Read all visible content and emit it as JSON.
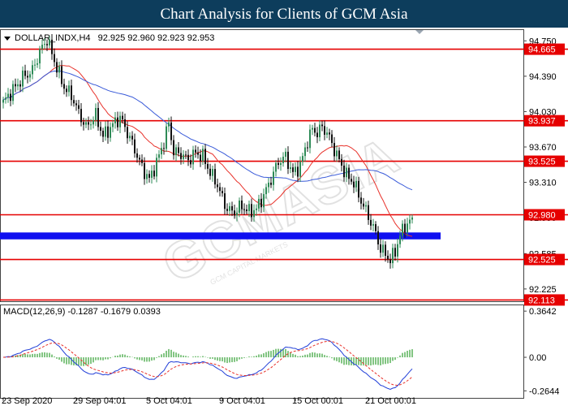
{
  "page": {
    "title": "Chart Analysis for Clients of GCM Asia"
  },
  "colors": {
    "banner": "#0d3d5c",
    "bull_candle": "#2e8b57",
    "bear_candle": "#111111",
    "level_line": "#e60000",
    "ma_fast": "#e8312a",
    "ma_slow": "#3a5bd9",
    "support_zone": "#1010f0",
    "macd_line": "#2340d8",
    "signal_line": "#e8312a",
    "histogram": "#2e9e2e"
  },
  "watermark": {
    "text": "GCMASIA",
    "subtext": "GCM CAPITAL MARKETS"
  },
  "chart_data": {
    "type": "candlestick",
    "symbol": "DOLLAR_INDX,H4",
    "ohlc_header": "92.925 92.960 92.923 92.953",
    "ylim": [
      92.1,
      94.86
    ],
    "price_ticks": [
      "94.750",
      "94.390",
      "94.030",
      "93.670",
      "93.310",
      "92.950",
      "92.585",
      "92.225"
    ],
    "price_tick_values": [
      94.75,
      94.39,
      94.03,
      93.67,
      93.31,
      92.95,
      92.585,
      92.225
    ],
    "time_labels": [
      "23 Sep 2020",
      "29 Sep 04:01",
      "5 Oct 04:01",
      "9 Oct 04:01",
      "15 Oct 00:01",
      "21 Oct 00:01"
    ],
    "time_label_bars": [
      0,
      30,
      60,
      90,
      120,
      150
    ],
    "levels": [
      {
        "label": "94.665",
        "value": 94.665
      },
      {
        "label": "93.937",
        "value": 93.937
      },
      {
        "label": "93.525",
        "value": 93.525
      },
      {
        "label": "92.980",
        "value": 92.98
      },
      {
        "label": "92.525",
        "value": 92.525
      },
      {
        "label": "92.113",
        "value": 92.113
      }
    ],
    "support_zone": {
      "from": 92.73,
      "to": 92.8,
      "start_bar": 0,
      "end_bar": 179
    },
    "close_anchors": [
      [
        0,
        94.1
      ],
      [
        4,
        94.25
      ],
      [
        8,
        94.4
      ],
      [
        12,
        94.45
      ],
      [
        15,
        94.62
      ],
      [
        18,
        94.75
      ],
      [
        21,
        94.55
      ],
      [
        25,
        94.3
      ],
      [
        28,
        94.2
      ],
      [
        31,
        94.0
      ],
      [
        34,
        93.85
      ],
      [
        38,
        94.0
      ],
      [
        41,
        93.8
      ],
      [
        45,
        93.9
      ],
      [
        48,
        93.95
      ],
      [
        51,
        93.8
      ],
      [
        54,
        93.65
      ],
      [
        57,
        93.48
      ],
      [
        60,
        93.35
      ],
      [
        63,
        93.5
      ],
      [
        66,
        93.7
      ],
      [
        68,
        93.9
      ],
      [
        70,
        93.62
      ],
      [
        73,
        93.62
      ],
      [
        76,
        93.55
      ],
      [
        79,
        93.6
      ],
      [
        82,
        93.55
      ],
      [
        85,
        93.4
      ],
      [
        88,
        93.3
      ],
      [
        91,
        93.1
      ],
      [
        93,
        93.03
      ],
      [
        95,
        93.0
      ],
      [
        98,
        93.05
      ],
      [
        101,
        93.0
      ],
      [
        104,
        93.05
      ],
      [
        107,
        93.2
      ],
      [
        110,
        93.35
      ],
      [
        113,
        93.5
      ],
      [
        116,
        93.55
      ],
      [
        119,
        93.4
      ],
      [
        122,
        93.5
      ],
      [
        125,
        93.75
      ],
      [
        127,
        93.85
      ],
      [
        129,
        93.8
      ],
      [
        131,
        93.85
      ],
      [
        133,
        93.8
      ],
      [
        135,
        93.7
      ],
      [
        138,
        93.55
      ],
      [
        141,
        93.4
      ],
      [
        144,
        93.3
      ],
      [
        147,
        93.1
      ],
      [
        150,
        92.95
      ],
      [
        153,
        92.8
      ],
      [
        155,
        92.65
      ],
      [
        157,
        92.6
      ],
      [
        159,
        92.52
      ],
      [
        161,
        92.6
      ],
      [
        163,
        92.75
      ],
      [
        165,
        92.85
      ],
      [
        167,
        92.9
      ],
      [
        168,
        92.95
      ]
    ],
    "moving_averages": [
      {
        "name": "",
        "period": 20,
        "color": "#e8312a"
      },
      {
        "name": "",
        "period": 50,
        "color": "#3a5bd9"
      }
    ],
    "macd": {
      "label": "MACD(12,26,9) -0.1287 -0.1679 0.0393",
      "params": [
        12,
        26,
        9
      ],
      "ylim": [
        -0.32,
        0.41
      ],
      "ticks": [
        "0.3642",
        "0.00",
        "-0.2644"
      ],
      "tick_values": [
        0.3642,
        0.0,
        -0.2644
      ]
    }
  }
}
